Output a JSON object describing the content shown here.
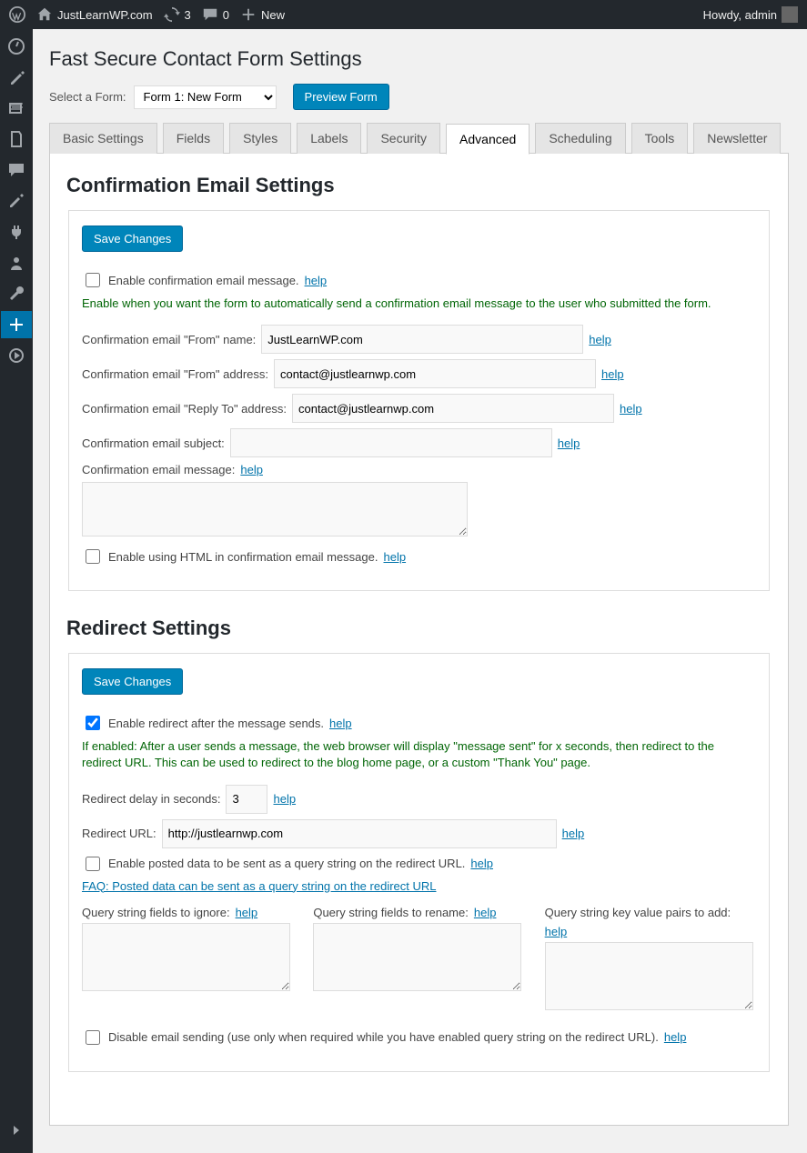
{
  "adminBar": {
    "site": "JustLearnWP.com",
    "updates": "3",
    "comments": "0",
    "newLabel": "New",
    "howdy": "Howdy, admin"
  },
  "page": {
    "title": "Fast Secure Contact Form Settings",
    "selectLabel": "Select a Form:",
    "selectedForm": "Form 1: New Form",
    "previewBtn": "Preview Form"
  },
  "tabs": {
    "basic": "Basic Settings",
    "fields": "Fields",
    "styles": "Styles",
    "labels": "Labels",
    "security": "Security",
    "advanced": "Advanced",
    "scheduling": "Scheduling",
    "tools": "Tools",
    "newsletter": "Newsletter"
  },
  "confirm": {
    "title": "Confirmation Email Settings",
    "save": "Save Changes",
    "enableLabel": "Enable confirmation email message.",
    "help": "help",
    "hint": "Enable when you want the form to automatically send a confirmation email message to the user who submitted the form.",
    "fromNameLabel": "Confirmation email \"From\" name:",
    "fromNameValue": "JustLearnWP.com",
    "fromAddrLabel": "Confirmation email \"From\" address:",
    "fromAddrValue": "contact@justlearnwp.com",
    "replyToLabel": "Confirmation email \"Reply To\" address:",
    "replyToValue": "contact@justlearnwp.com",
    "subjectLabel": "Confirmation email subject:",
    "subjectValue": "",
    "messageLabel": "Confirmation email message:",
    "messageValue": "",
    "enableHtmlLabel": "Enable using HTML in confirmation email message."
  },
  "redirect": {
    "title": "Redirect Settings",
    "save": "Save Changes",
    "enableLabel": "Enable redirect after the message sends.",
    "help": "help",
    "hint": "If enabled: After a user sends a message, the web browser will display \"message sent\" for x seconds, then redirect to the redirect URL. This can be used to redirect to the blog home page, or a custom \"Thank You\" page.",
    "delayLabel": "Redirect delay in seconds:",
    "delayValue": "3",
    "urlLabel": "Redirect URL:",
    "urlValue": "http://justlearnwp.com",
    "postedLabel": "Enable posted data to be sent as a query string on the redirect URL.",
    "faq": "FAQ: Posted data can be sent as a query string on the redirect URL",
    "qIgnoreLabel": "Query string fields to ignore:",
    "qRenameLabel": "Query string fields to rename:",
    "qAddLabel": "Query string key value pairs to add:",
    "disableEmailLabel": "Disable email sending (use only when required while you have enabled query string on the redirect URL)."
  }
}
